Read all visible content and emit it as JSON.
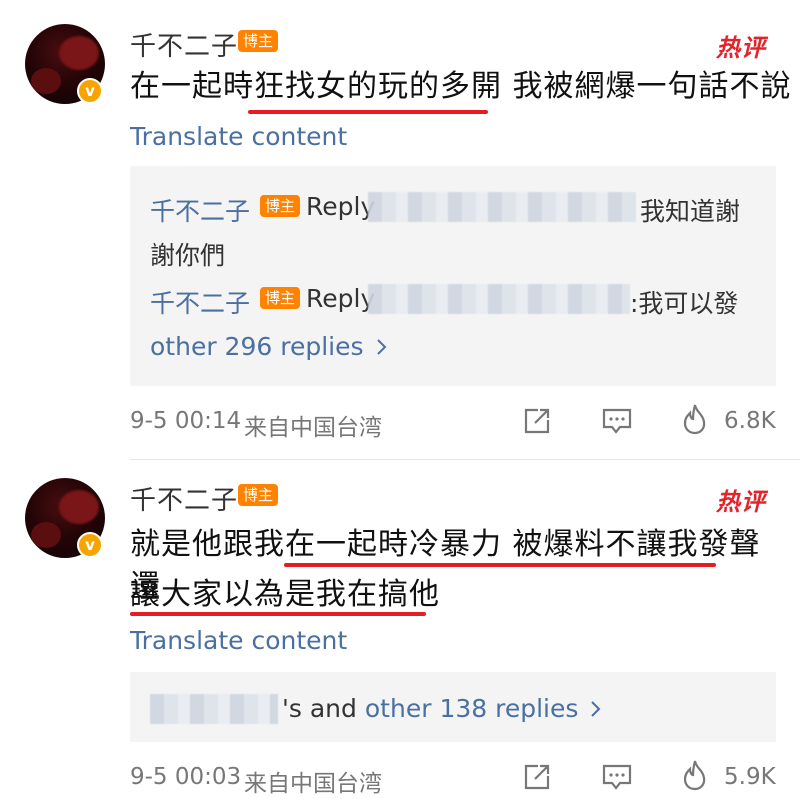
{
  "comments": [
    {
      "username": "千不二子",
      "badge": "博主",
      "hot_label": "热评",
      "verified_mark": "v",
      "text_line1": "在一起時狂找女的玩的多開 我被網爆一句話不說",
      "translate": "Translate content",
      "replies": [
        {
          "name": "千不二子",
          "badge": "博主",
          "prefix": "Reply",
          "text_end": "我知道謝",
          "text_wrap": "謝你們"
        },
        {
          "name": "千不二子",
          "badge": "博主",
          "prefix": "Reply",
          "text_end": ":我可以發"
        }
      ],
      "more_replies": "other 296 replies",
      "time": "9-5 00:14",
      "source": "来自中国台湾",
      "likes": "6.8K"
    },
    {
      "username": "千不二子",
      "badge": "博主",
      "hot_label": "热评",
      "verified_mark": "v",
      "text_line1": "就是他跟我在一起時冷暴力 被爆料不讓我發聲 還",
      "text_line2": "讓大家以為是我在搞他",
      "translate": "Translate content",
      "reply_suffix": "'s and",
      "more_replies": "other 138 replies",
      "time": "9-5 00:03",
      "source": "来自中国台湾",
      "likes": "5.9K"
    }
  ],
  "colors": {
    "accent_link": "#4a6fa1",
    "underline": "#e61c24",
    "blogger_badge": "#ff8200",
    "hot": "#e3252b"
  },
  "icons": [
    "share-icon",
    "comment-icon",
    "like-flame-icon",
    "chevron-right-icon"
  ]
}
